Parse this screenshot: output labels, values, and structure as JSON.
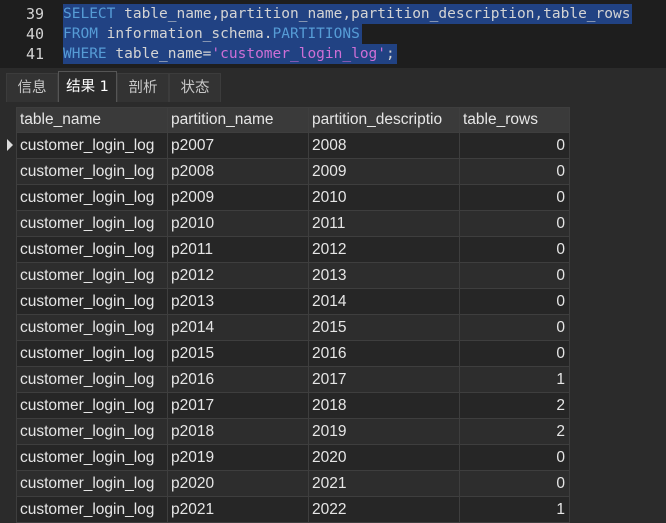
{
  "editor": {
    "lines": [
      {
        "number": "39",
        "parts": [
          {
            "text": "SELECT",
            "kind": "keyword"
          },
          {
            "text": " table_name,partition_name,partition_description,table_rows",
            "kind": "plain"
          }
        ]
      },
      {
        "number": "40",
        "parts": [
          {
            "text": "FROM",
            "kind": "keyword"
          },
          {
            "text": " information_schema.",
            "kind": "plain"
          },
          {
            "text": "PARTITIONS",
            "kind": "keyword"
          }
        ]
      },
      {
        "number": "41",
        "parts": [
          {
            "text": "WHERE",
            "kind": "keyword"
          },
          {
            "text": " table_name=",
            "kind": "plain"
          },
          {
            "text": "'customer_login_log'",
            "kind": "string"
          },
          {
            "text": ";",
            "kind": "plain"
          }
        ]
      }
    ]
  },
  "tabs": [
    {
      "label": "信息",
      "active": false
    },
    {
      "label": "结果 1",
      "active": true
    },
    {
      "label": "剖析",
      "active": false
    },
    {
      "label": "状态",
      "active": false
    }
  ],
  "result": {
    "columns": [
      "table_name",
      "partition_name",
      "partition_descriptio",
      "table_rows"
    ],
    "rows": [
      [
        "customer_login_log",
        "p2007",
        "2008",
        "0"
      ],
      [
        "customer_login_log",
        "p2008",
        "2009",
        "0"
      ],
      [
        "customer_login_log",
        "p2009",
        "2010",
        "0"
      ],
      [
        "customer_login_log",
        "p2010",
        "2011",
        "0"
      ],
      [
        "customer_login_log",
        "p2011",
        "2012",
        "0"
      ],
      [
        "customer_login_log",
        "p2012",
        "2013",
        "0"
      ],
      [
        "customer_login_log",
        "p2013",
        "2014",
        "0"
      ],
      [
        "customer_login_log",
        "p2014",
        "2015",
        "0"
      ],
      [
        "customer_login_log",
        "p2015",
        "2016",
        "0"
      ],
      [
        "customer_login_log",
        "p2016",
        "2017",
        "1"
      ],
      [
        "customer_login_log",
        "p2017",
        "2018",
        "2"
      ],
      [
        "customer_login_log",
        "p2018",
        "2019",
        "2"
      ],
      [
        "customer_login_log",
        "p2019",
        "2020",
        "0"
      ],
      [
        "customer_login_log",
        "p2020",
        "2021",
        "0"
      ],
      [
        "customer_login_log",
        "p2021",
        "2022",
        "1"
      ]
    ]
  },
  "colors": {
    "selection": "#214283",
    "keyword": "#569cd6",
    "string": "#ce6fd6"
  }
}
